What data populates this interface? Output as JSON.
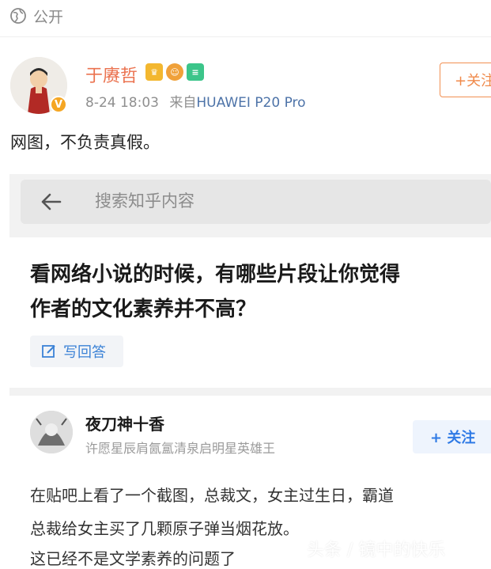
{
  "visibility": {
    "label": "公开",
    "icon": "globe-icon"
  },
  "post": {
    "author": "于赓哲",
    "badges": [
      "crown-badge",
      "medal-badge",
      "member-badge"
    ],
    "verified_icon": "v-verified-icon",
    "date": "8-24 18:03",
    "source_prefix": "来自",
    "source_device": "HUAWEI P20 Pro",
    "follow_label": "+关注",
    "text": "网图，不负责真假。",
    "colors": {
      "username": "#eb7350",
      "follow": "#f08a4b",
      "device": "#4d73a8"
    }
  },
  "screenshot": {
    "search": {
      "placeholder": "搜索知乎内容",
      "back_icon": "back-arrow-icon"
    },
    "question": {
      "lines": [
        "看网络小说的时候，有哪些片段让你觉得",
        "作者的文化素养并不高？"
      ],
      "write_label": "写回答",
      "write_icon": "edit-icon"
    },
    "answer": {
      "author": "夜刀神十香",
      "bio": "许愿星辰肩氤氲清泉启明星英雄王",
      "follow_label": "+ 关注",
      "lines": [
        "在贴吧上看了一个截图，总裁文，女主过生日，霸道",
        "总裁给女主买了几颗原子弹当烟花放。",
        "这已经不是文学素养的问题了"
      ]
    },
    "watermark": "头条 / 镜中的快乐"
  }
}
